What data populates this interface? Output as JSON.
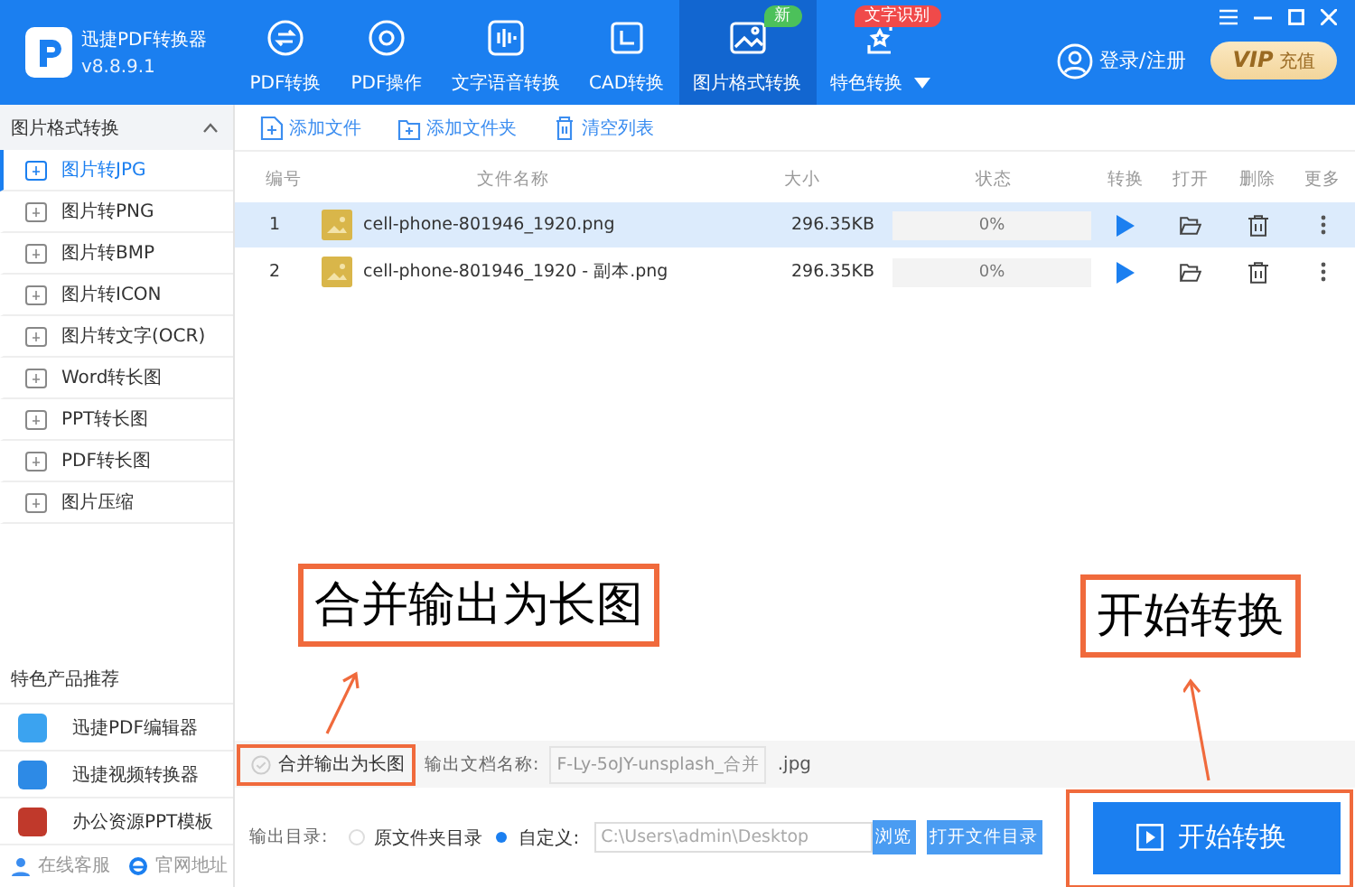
{
  "app": {
    "name": "迅捷PDF转换器",
    "version": "v8.8.9.1"
  },
  "nav_tabs": [
    {
      "label": "PDF转换",
      "selected": false
    },
    {
      "label": "PDF操作",
      "selected": false
    },
    {
      "label": "文字语音转换",
      "selected": false
    },
    {
      "label": "CAD转换",
      "selected": false
    },
    {
      "label": "图片格式转换",
      "selected": true,
      "badge": "新"
    },
    {
      "label": "特色转换",
      "selected": false,
      "badge": "文字识别",
      "dropdown": true
    }
  ],
  "account": {
    "login": "登录/注册",
    "vip_label": "VIP",
    "vip_action": "充值"
  },
  "sidebar": {
    "section_title": "图片格式转换",
    "expanded": true,
    "items": [
      {
        "label": "图片转JPG",
        "selected": true
      },
      {
        "label": "图片转PNG",
        "selected": false
      },
      {
        "label": "图片转BMP",
        "selected": false
      },
      {
        "label": "图片转ICON",
        "selected": false
      },
      {
        "label": "图片转文字(OCR)",
        "selected": false
      },
      {
        "label": "Word转长图",
        "selected": false
      },
      {
        "label": "PPT转长图",
        "selected": false
      },
      {
        "label": "PDF转长图",
        "selected": false
      },
      {
        "label": "图片压缩",
        "selected": false
      }
    ],
    "promo_title": "特色产品推荐",
    "promos": [
      "迅捷PDF编辑器",
      "迅捷视频转换器",
      "办公资源PPT模板"
    ],
    "footer_links": [
      "在线客服",
      "官网地址"
    ]
  },
  "toolbar": [
    "添加文件",
    "添加文件夹",
    "清空列表"
  ],
  "table": {
    "columns": [
      "编号",
      "文件名称",
      "大小",
      "状态",
      "转换",
      "打开",
      "删除",
      "更多"
    ],
    "rows": [
      {
        "index": "1",
        "name": "cell-phone-801946_1920.png",
        "size": "296.35KB",
        "status": "0%",
        "level": 0,
        "selected": true
      },
      {
        "index": "2",
        "name": "cell-phone-801946_1920 - 副本.png",
        "size": "296.35KB",
        "status": "0%",
        "level": 0,
        "selected": false
      }
    ]
  },
  "options": {
    "merge_label": "合并输出为长图",
    "merge_checked": false,
    "output_name_label": "输出文档名称:",
    "output_name_value": "F-Ly-5oJY-unsplash_合并",
    "extension": ".jpg",
    "output_dir_label": "输出目录:",
    "dir_options": [
      {
        "label": "原文件夹目录",
        "selected": false
      },
      {
        "label": "自定义:",
        "selected": true
      }
    ],
    "dir_path": "C:\\Users\\admin\\Desktop",
    "browse": "浏览",
    "open_dir": "打开文件目录"
  },
  "start_button": "开始转换",
  "annotations": [
    {
      "text": "合并输出为长图"
    },
    {
      "text": "开始转换"
    }
  ]
}
